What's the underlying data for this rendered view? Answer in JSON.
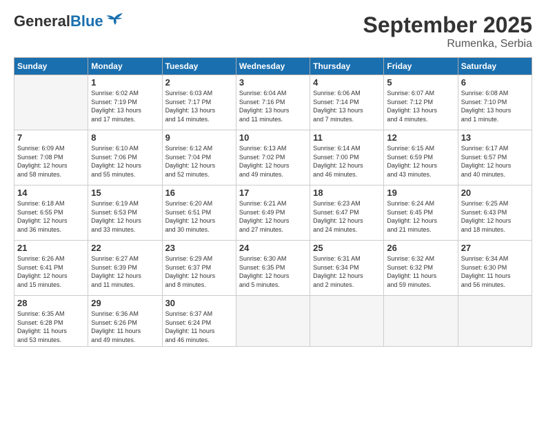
{
  "logo": {
    "line1": "General",
    "line2": "Blue"
  },
  "header": {
    "month_year": "September 2025",
    "location": "Rumenka, Serbia"
  },
  "weekdays": [
    "Sunday",
    "Monday",
    "Tuesday",
    "Wednesday",
    "Thursday",
    "Friday",
    "Saturday"
  ],
  "weeks": [
    [
      {
        "day": "",
        "info": ""
      },
      {
        "day": "1",
        "info": "Sunrise: 6:02 AM\nSunset: 7:19 PM\nDaylight: 13 hours\nand 17 minutes."
      },
      {
        "day": "2",
        "info": "Sunrise: 6:03 AM\nSunset: 7:17 PM\nDaylight: 13 hours\nand 14 minutes."
      },
      {
        "day": "3",
        "info": "Sunrise: 6:04 AM\nSunset: 7:16 PM\nDaylight: 13 hours\nand 11 minutes."
      },
      {
        "day": "4",
        "info": "Sunrise: 6:06 AM\nSunset: 7:14 PM\nDaylight: 13 hours\nand 7 minutes."
      },
      {
        "day": "5",
        "info": "Sunrise: 6:07 AM\nSunset: 7:12 PM\nDaylight: 13 hours\nand 4 minutes."
      },
      {
        "day": "6",
        "info": "Sunrise: 6:08 AM\nSunset: 7:10 PM\nDaylight: 13 hours\nand 1 minute."
      }
    ],
    [
      {
        "day": "7",
        "info": "Sunrise: 6:09 AM\nSunset: 7:08 PM\nDaylight: 12 hours\nand 58 minutes."
      },
      {
        "day": "8",
        "info": "Sunrise: 6:10 AM\nSunset: 7:06 PM\nDaylight: 12 hours\nand 55 minutes."
      },
      {
        "day": "9",
        "info": "Sunrise: 6:12 AM\nSunset: 7:04 PM\nDaylight: 12 hours\nand 52 minutes."
      },
      {
        "day": "10",
        "info": "Sunrise: 6:13 AM\nSunset: 7:02 PM\nDaylight: 12 hours\nand 49 minutes."
      },
      {
        "day": "11",
        "info": "Sunrise: 6:14 AM\nSunset: 7:00 PM\nDaylight: 12 hours\nand 46 minutes."
      },
      {
        "day": "12",
        "info": "Sunrise: 6:15 AM\nSunset: 6:59 PM\nDaylight: 12 hours\nand 43 minutes."
      },
      {
        "day": "13",
        "info": "Sunrise: 6:17 AM\nSunset: 6:57 PM\nDaylight: 12 hours\nand 40 minutes."
      }
    ],
    [
      {
        "day": "14",
        "info": "Sunrise: 6:18 AM\nSunset: 6:55 PM\nDaylight: 12 hours\nand 36 minutes."
      },
      {
        "day": "15",
        "info": "Sunrise: 6:19 AM\nSunset: 6:53 PM\nDaylight: 12 hours\nand 33 minutes."
      },
      {
        "day": "16",
        "info": "Sunrise: 6:20 AM\nSunset: 6:51 PM\nDaylight: 12 hours\nand 30 minutes."
      },
      {
        "day": "17",
        "info": "Sunrise: 6:21 AM\nSunset: 6:49 PM\nDaylight: 12 hours\nand 27 minutes."
      },
      {
        "day": "18",
        "info": "Sunrise: 6:23 AM\nSunset: 6:47 PM\nDaylight: 12 hours\nand 24 minutes."
      },
      {
        "day": "19",
        "info": "Sunrise: 6:24 AM\nSunset: 6:45 PM\nDaylight: 12 hours\nand 21 minutes."
      },
      {
        "day": "20",
        "info": "Sunrise: 6:25 AM\nSunset: 6:43 PM\nDaylight: 12 hours\nand 18 minutes."
      }
    ],
    [
      {
        "day": "21",
        "info": "Sunrise: 6:26 AM\nSunset: 6:41 PM\nDaylight: 12 hours\nand 15 minutes."
      },
      {
        "day": "22",
        "info": "Sunrise: 6:27 AM\nSunset: 6:39 PM\nDaylight: 12 hours\nand 11 minutes."
      },
      {
        "day": "23",
        "info": "Sunrise: 6:29 AM\nSunset: 6:37 PM\nDaylight: 12 hours\nand 8 minutes."
      },
      {
        "day": "24",
        "info": "Sunrise: 6:30 AM\nSunset: 6:35 PM\nDaylight: 12 hours\nand 5 minutes."
      },
      {
        "day": "25",
        "info": "Sunrise: 6:31 AM\nSunset: 6:34 PM\nDaylight: 12 hours\nand 2 minutes."
      },
      {
        "day": "26",
        "info": "Sunrise: 6:32 AM\nSunset: 6:32 PM\nDaylight: 11 hours\nand 59 minutes."
      },
      {
        "day": "27",
        "info": "Sunrise: 6:34 AM\nSunset: 6:30 PM\nDaylight: 11 hours\nand 56 minutes."
      }
    ],
    [
      {
        "day": "28",
        "info": "Sunrise: 6:35 AM\nSunset: 6:28 PM\nDaylight: 11 hours\nand 53 minutes."
      },
      {
        "day": "29",
        "info": "Sunrise: 6:36 AM\nSunset: 6:26 PM\nDaylight: 11 hours\nand 49 minutes."
      },
      {
        "day": "30",
        "info": "Sunrise: 6:37 AM\nSunset: 6:24 PM\nDaylight: 11 hours\nand 46 minutes."
      },
      {
        "day": "",
        "info": ""
      },
      {
        "day": "",
        "info": ""
      },
      {
        "day": "",
        "info": ""
      },
      {
        "day": "",
        "info": ""
      }
    ]
  ]
}
